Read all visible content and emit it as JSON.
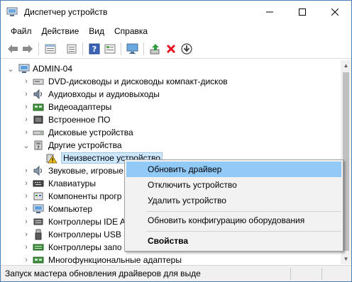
{
  "window": {
    "title": "Диспетчер устройств",
    "controls": {
      "minimize": "—",
      "maximize": "☐",
      "close": "✕"
    }
  },
  "menu": [
    "Файл",
    "Действие",
    "Вид",
    "Справка"
  ],
  "toolbar": {
    "buttons": [
      "back-icon",
      "forward-icon",
      "properties-icon",
      "list-icon",
      "help-icon",
      "view-icon",
      "monitor-icon",
      "update-driver-icon",
      "uninstall-icon",
      "download-icon"
    ]
  },
  "tree": {
    "root": "ADMIN-04",
    "items": [
      {
        "label": "DVD-дисководы и дисководы компакт-дисков",
        "icon": "dvd-icon",
        "expanded": false
      },
      {
        "label": "Аудиовходы и аудиовыходы",
        "icon": "audio-icon",
        "expanded": false
      },
      {
        "label": "Видеоадаптеры",
        "icon": "display-adapter-icon",
        "expanded": false
      },
      {
        "label": "Встроенное ПО",
        "icon": "firmware-icon",
        "expanded": false
      },
      {
        "label": "Дисковые устройства",
        "icon": "disk-icon",
        "expanded": false
      },
      {
        "label": "Другие устройства",
        "icon": "other-devices-icon",
        "expanded": true
      },
      {
        "label": "Неизвестное устройство",
        "icon": "warning-device-icon",
        "child": true,
        "selected": true
      },
      {
        "label": "Звуковые, игровые",
        "icon": "sound-icon",
        "expanded": false
      },
      {
        "label": "Клавиатуры",
        "icon": "keyboard-icon",
        "expanded": false
      },
      {
        "label": "Компоненты прогр",
        "icon": "software-component-icon",
        "expanded": false
      },
      {
        "label": "Компьютер",
        "icon": "computer-icon",
        "expanded": false
      },
      {
        "label": "Контроллеры IDE A",
        "icon": "ide-icon",
        "expanded": false
      },
      {
        "label": "Контроллеры USB",
        "icon": "usb-icon",
        "expanded": false
      },
      {
        "label": "Контроллеры запо",
        "icon": "storage-controller-icon",
        "expanded": false
      },
      {
        "label": "Многофункциональные адаптеры",
        "icon": "multifunction-icon",
        "expanded": false
      }
    ]
  },
  "context_menu": {
    "items": [
      {
        "label": "Обновить драйвер",
        "highlighted": true
      },
      {
        "label": "Отключить устройство"
      },
      {
        "label": "Удалить устройство"
      },
      {
        "label": "Обновить конфигурацию оборудования"
      },
      {
        "label": "Свойства",
        "bold": true
      }
    ]
  },
  "status": {
    "text": "Запуск мастера обновления драйверов для выде"
  },
  "colors": {
    "highlight": "#91c9f7",
    "selection": "#cce8ff",
    "uninstall_red": "#e81123",
    "update_green": "#2e9e3e"
  }
}
